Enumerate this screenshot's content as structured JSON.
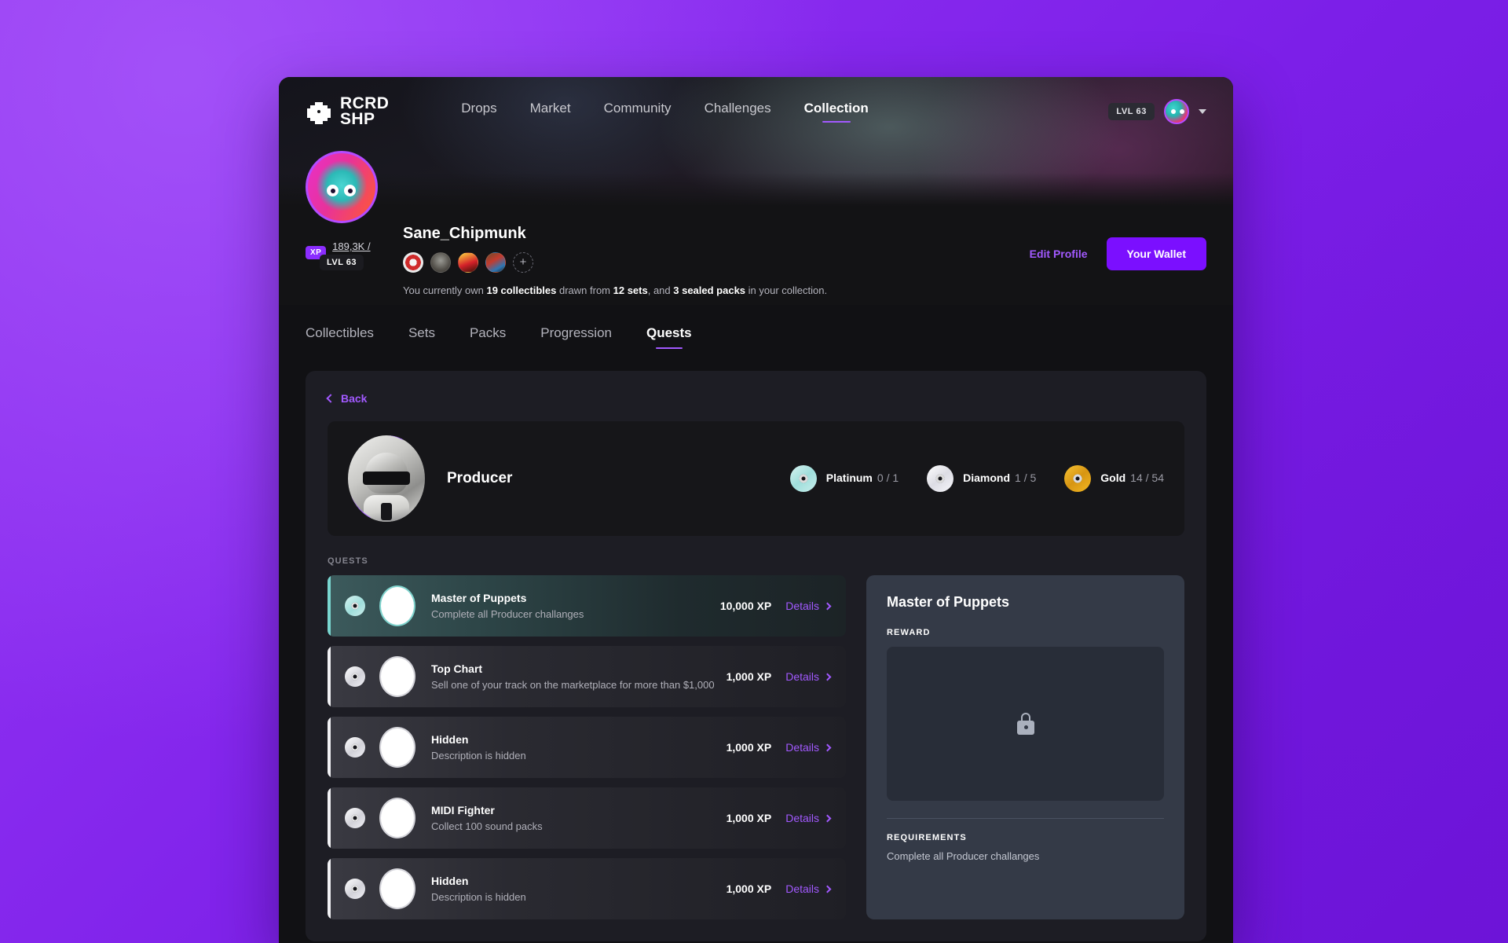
{
  "header": {
    "logo_line1": "RCRD",
    "logo_line2": "SHP",
    "nav": [
      {
        "label": "Drops",
        "active": false
      },
      {
        "label": "Market",
        "active": false
      },
      {
        "label": "Community",
        "active": false
      },
      {
        "label": "Challenges",
        "active": false
      },
      {
        "label": "Collection",
        "active": true
      }
    ],
    "level_pill": "LVL 63",
    "avatar_icon": "user-avatar-icon",
    "caret_icon": "chevron-down-icon"
  },
  "profile": {
    "username": "Sane_Chipmunk",
    "avatar_level": "LVL 63",
    "xp_label": "XP",
    "xp_value": "189,3K / 230K",
    "badges": [
      "badge-rhcp-icon",
      "badge-misfits-icon",
      "badge-lightning-icon",
      "badge-art-icon"
    ],
    "add_badge": "+",
    "stats": {
      "prefix": "You currently own ",
      "collectibles": "19 collectibles",
      "mid1": " drawn from ",
      "sets": "12 sets",
      "mid2": ", and ",
      "packs": "3 sealed packs",
      "suffix": " in your collection."
    },
    "edit_profile": "Edit Profile",
    "wallet_button": "Your Wallet"
  },
  "tabs": [
    {
      "label": "Collectibles",
      "active": false
    },
    {
      "label": "Sets",
      "active": false
    },
    {
      "label": "Packs",
      "active": false
    },
    {
      "label": "Progression",
      "active": false
    },
    {
      "label": "Quests",
      "active": true
    }
  ],
  "panel": {
    "back_label": "Back",
    "producer": {
      "name": "Producer",
      "avatar_icon": "producer-avatar-icon",
      "tiers": [
        {
          "name": "Platinum",
          "count": "0 / 1",
          "color": "#b9e7e4"
        },
        {
          "name": "Diamond",
          "count": "1 / 5",
          "color": "#eaeaf0"
        },
        {
          "name": "Gold",
          "count": "14 / 54",
          "color": "#e4a91b"
        }
      ]
    },
    "quests_label": "QUESTS",
    "quests": [
      {
        "title": "Master of Puppets",
        "desc": "Complete all Producer challanges",
        "xp": "10,000 XP",
        "details": "Details",
        "selected": true
      },
      {
        "title": "Top Chart",
        "desc": "Sell one of your track on the marketplace for more than $1,000",
        "xp": "1,000 XP",
        "details": "Details",
        "selected": false
      },
      {
        "title": "Hidden",
        "desc": "Description is hidden",
        "xp": "1,000 XP",
        "details": "Details",
        "selected": false
      },
      {
        "title": "MIDI Fighter",
        "desc": "Collect 100 sound packs",
        "xp": "1,000 XP",
        "details": "Details",
        "selected": false
      },
      {
        "title": "Hidden",
        "desc": "Description is hidden",
        "xp": "1,000 XP",
        "details": "Details",
        "selected": false
      }
    ],
    "detail": {
      "title": "Master of Puppets",
      "reward_label": "REWARD",
      "reward_icon": "lock-icon",
      "requirements_label": "REQUIREMENTS",
      "requirements_text": "Complete all Producer challanges"
    }
  },
  "colors": {
    "accent": "#a259ff",
    "button": "#7b0fff",
    "panel": "#1d1d24",
    "detail_panel": "#343a47"
  }
}
